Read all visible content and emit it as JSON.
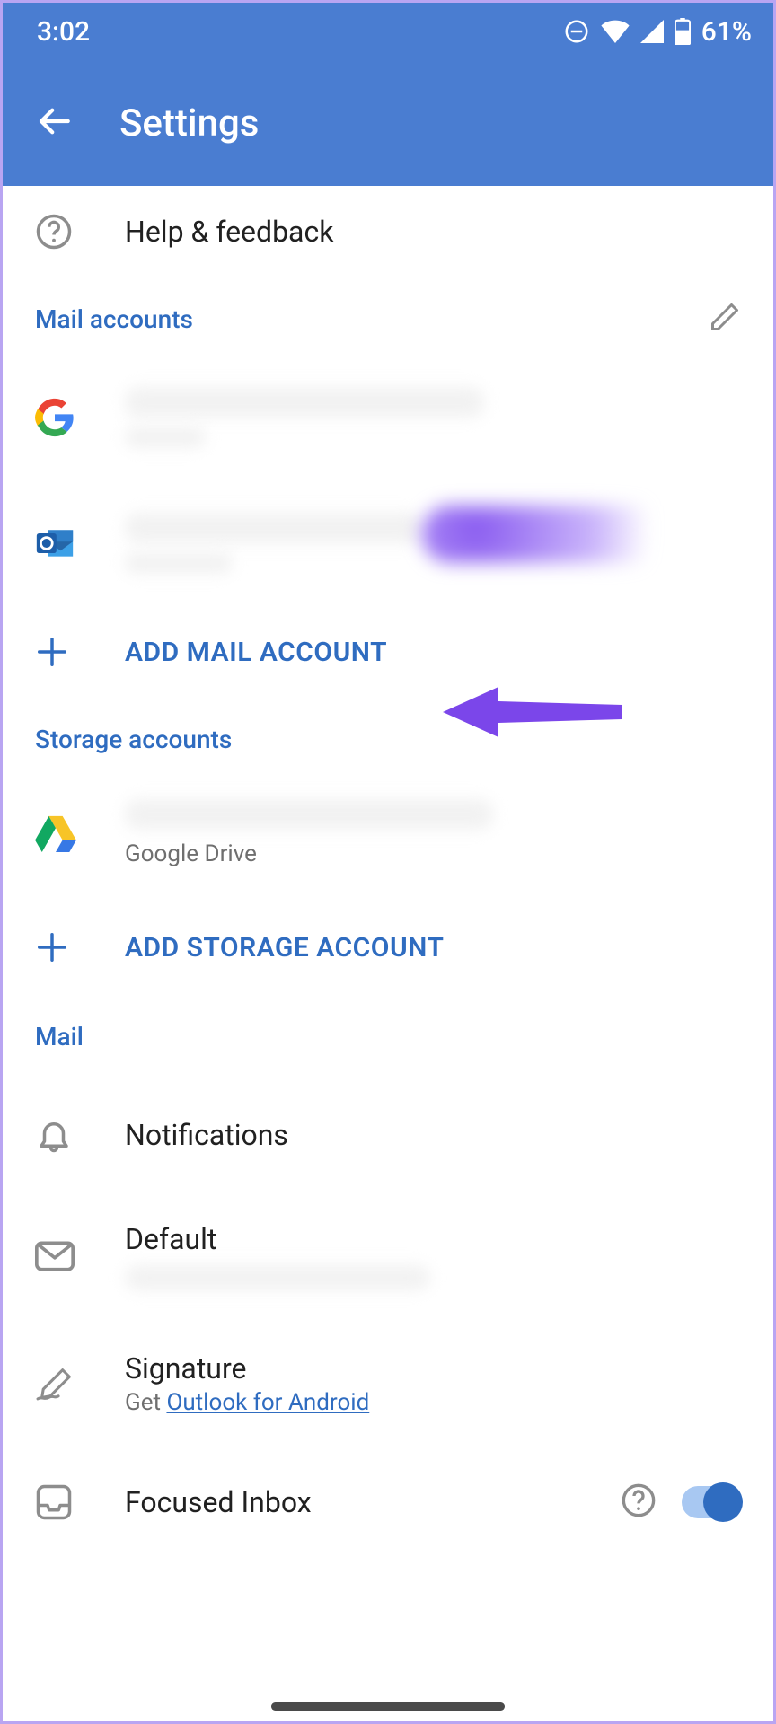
{
  "status": {
    "time": "3:02",
    "battery_text": "61%"
  },
  "appbar": {
    "title": "Settings"
  },
  "help": {
    "label": "Help & feedback"
  },
  "sections": {
    "mail_accounts": "Mail accounts",
    "storage_accounts": "Storage accounts",
    "mail": "Mail"
  },
  "actions": {
    "add_mail": "ADD MAIL ACCOUNT",
    "add_storage": "ADD STORAGE ACCOUNT"
  },
  "storage": {
    "drive_label": "Google Drive"
  },
  "mail_settings": {
    "notifications": "Notifications",
    "default": "Default",
    "signature": "Signature",
    "signature_sub_prefix": "Get ",
    "signature_link": "Outlook for Android",
    "focused": "Focused Inbox"
  }
}
